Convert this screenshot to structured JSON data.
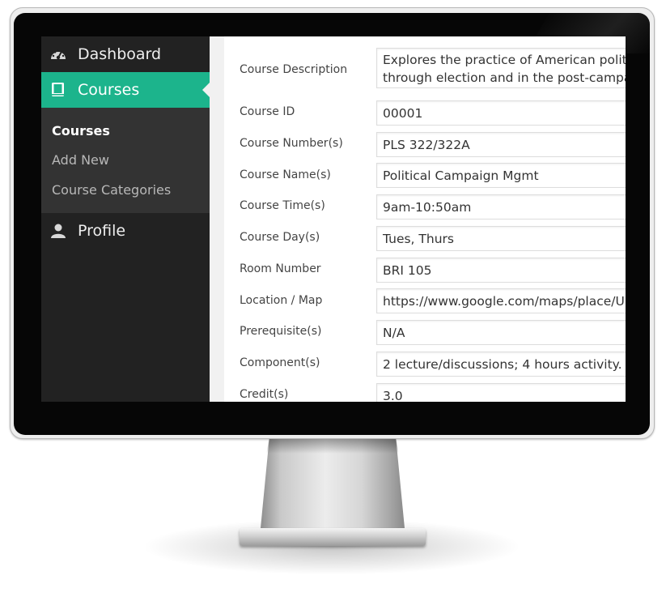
{
  "sidebar": {
    "menu": {
      "dashboard": {
        "label": "Dashboard",
        "icon": "dashboard-gauge-icon"
      },
      "courses": {
        "label": "Courses",
        "icon": "book-icon"
      },
      "profile": {
        "label": "Profile",
        "icon": "user-icon"
      }
    },
    "submenu": {
      "courses": "Courses",
      "add_new": "Add New",
      "categories": "Course Categories"
    }
  },
  "form": {
    "description": {
      "label": "Course Description",
      "value": "Explores the practice of American politi through election and in the post-campa"
    },
    "course_id": {
      "label": "Course ID",
      "value": "00001"
    },
    "number": {
      "label": "Course Number(s)",
      "value": "PLS 322/322A"
    },
    "name": {
      "label": "Course Name(s)",
      "value": "Political  Campaign  Mgmt"
    },
    "time": {
      "label": "Course Time(s)",
      "value": "9am-10:50am"
    },
    "day": {
      "label": "Course Day(s)",
      "value": "Tues, Thurs"
    },
    "room": {
      "label": "Room Number",
      "value": "BRI 105"
    },
    "location": {
      "label": "Location / Map",
      "value": "https://www.google.com/maps/place/U"
    },
    "prereq": {
      "label": "Prerequisite(s)",
      "value": "N/A"
    },
    "component": {
      "label": "Component(s)",
      "value": "2 lecture/discussions; 4 hours activity."
    },
    "credit": {
      "label": "Credit(s)",
      "value": "3.0"
    }
  },
  "colors": {
    "accent": "#1cb48c",
    "sidebar_bg": "#222222",
    "submenu_bg": "#333333"
  }
}
